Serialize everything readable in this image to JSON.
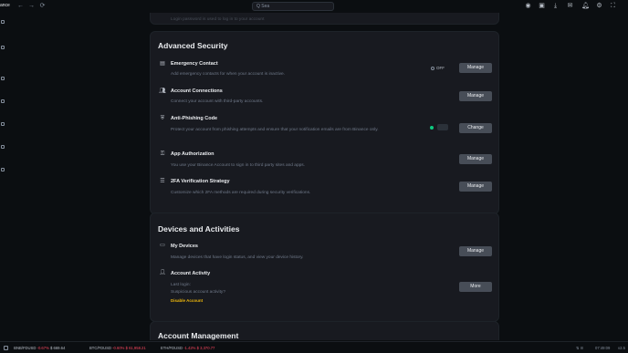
{
  "app": {
    "brand": "ance",
    "search_placeholder": "Q Sea"
  },
  "top_card": {
    "desc": "Login password is used to log in to your account"
  },
  "advanced_security": {
    "title": "Advanced Security",
    "rows": [
      {
        "title": "Emergency Contact",
        "desc": "Add emergency contacts for when your account is inactive.",
        "status": "OFF",
        "button": "Manage",
        "icon": "contact-book-icon"
      },
      {
        "title": "Account Connections",
        "desc": "Connect your account with third-party accounts.",
        "button": "Manage",
        "icon": "people-icon"
      },
      {
        "title": "Anti-Phishing Code",
        "desc": "Protect your account from phishing attempts and ensure that your notification emails are from Binance only.",
        "button": "Change",
        "icon": "shield-icon"
      },
      {
        "title": "App Authorization",
        "desc": "You use your Binance Account to sign in to third party sites and apps.",
        "button": "Manage",
        "icon": "app-key-icon"
      },
      {
        "title": "2FA Verification Strategy",
        "desc": "Customize which 2FA methods are required during security verifications.",
        "button": "Manage",
        "icon": "sliders-icon"
      }
    ]
  },
  "devices": {
    "title": "Devices and Activities",
    "rows": [
      {
        "title": "My Devices",
        "desc": "Manage devices that have login status, and view your device history.",
        "button": "Manage",
        "icon": "device-icon"
      },
      {
        "title": "Account Activity",
        "desc_1": "Last login:",
        "desc_2": "Suspicious account activity?",
        "link": "Disable Account",
        "button": "More",
        "icon": "activity-icon"
      }
    ]
  },
  "account_management": {
    "title": "Account Management"
  },
  "ticker": [
    {
      "pair": "BNB/FDUSD",
      "change": "-0.67%",
      "price": "$ 669.64",
      "dir": "down"
    },
    {
      "pair": "BTC/FDUSD",
      "change": "-0.60%",
      "price": "$ 61,958.21",
      "dir": "down"
    },
    {
      "pair": "ETH/FDUSD",
      "change": "-1.42%",
      "price": "$ 3,370.77",
      "dir": "down"
    }
  ],
  "status_bar": {
    "time": "07:49:09",
    "extra": "v2.5"
  }
}
